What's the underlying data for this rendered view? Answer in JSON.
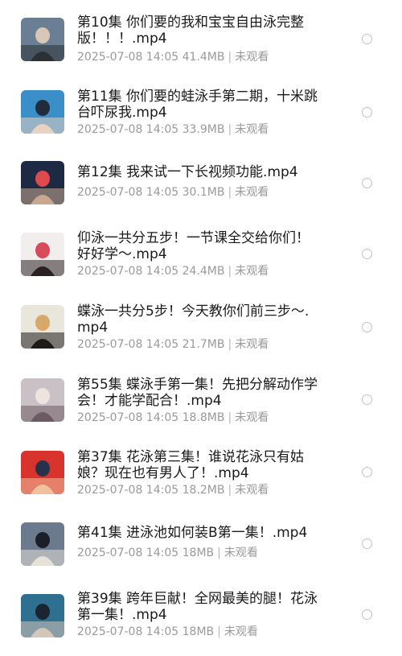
{
  "files": [
    {
      "title": "第10集 你们要的我和宝宝自由泳完整版！！！.mp4",
      "date": "2025-07-08 14:05",
      "size": "41.4MB",
      "status": "未观看",
      "thumb_colors": [
        "#6a7f93",
        "#2b2f36",
        "#d9c6b6"
      ]
    },
    {
      "title": "第11集 你们要的蛙泳手第二期，十米跳台吓尿我.mp4",
      "date": "2025-07-08 14:05",
      "size": "33.9MB",
      "status": "未观看",
      "thumb_colors": [
        "#3b8fc9",
        "#e8d2c2",
        "#1f2d3d"
      ]
    },
    {
      "title": "第12集 我来试一下长视频功能.mp4",
      "date": "2025-07-08 14:05",
      "size": "30.1MB",
      "status": "未观看",
      "thumb_colors": [
        "#1e2a44",
        "#c8a98f",
        "#e04a4a"
      ]
    },
    {
      "title": "仰泳一共分五步！一节课全交给你们！好好学～.mp4",
      "date": "2025-07-08 14:05",
      "size": "24.4MB",
      "status": "未观看",
      "thumb_colors": [
        "#f2eeee",
        "#2a2222",
        "#d94a5a"
      ]
    },
    {
      "title": "蝶泳一共分5步！今天教你们前三步～.mp4",
      "date": "2025-07-08 14:05",
      "size": "21.7MB",
      "status": "未观看",
      "thumb_colors": [
        "#e9e6dc",
        "#1f1a1a",
        "#d8a86a"
      ]
    },
    {
      "title": "第55集 蝶泳手第一集！先把分解动作学会！才能学配合！.mp4",
      "date": "2025-07-08 14:05",
      "size": "18.8MB",
      "status": "未观看",
      "thumb_colors": [
        "#c9c1c6",
        "#6d5b63",
        "#efe3e0"
      ]
    },
    {
      "title": "第37集 花泳第三集！谁说花泳只有姑娘？现在也有男人了！.mp4",
      "date": "2025-07-08 14:05",
      "size": "18.2MB",
      "status": "未观看",
      "thumb_colors": [
        "#d8332d",
        "#f0c19e",
        "#26324a"
      ]
    },
    {
      "title": "第41集 进泳池如何装B第一集！.mp4",
      "date": "2025-07-08 14:05",
      "size": "18MB",
      "status": "未观看",
      "thumb_colors": [
        "#6b7a8c",
        "#e7e1da",
        "#1a1f2a"
      ]
    },
    {
      "title": "第39集 跨年巨献！全网最美的腿！花泳第一集！.mp4",
      "date": "2025-07-08 14:05",
      "size": "18MB",
      "status": "未观看",
      "thumb_colors": [
        "#2f6f8f",
        "#d3c7b8",
        "#1b2530"
      ]
    }
  ]
}
